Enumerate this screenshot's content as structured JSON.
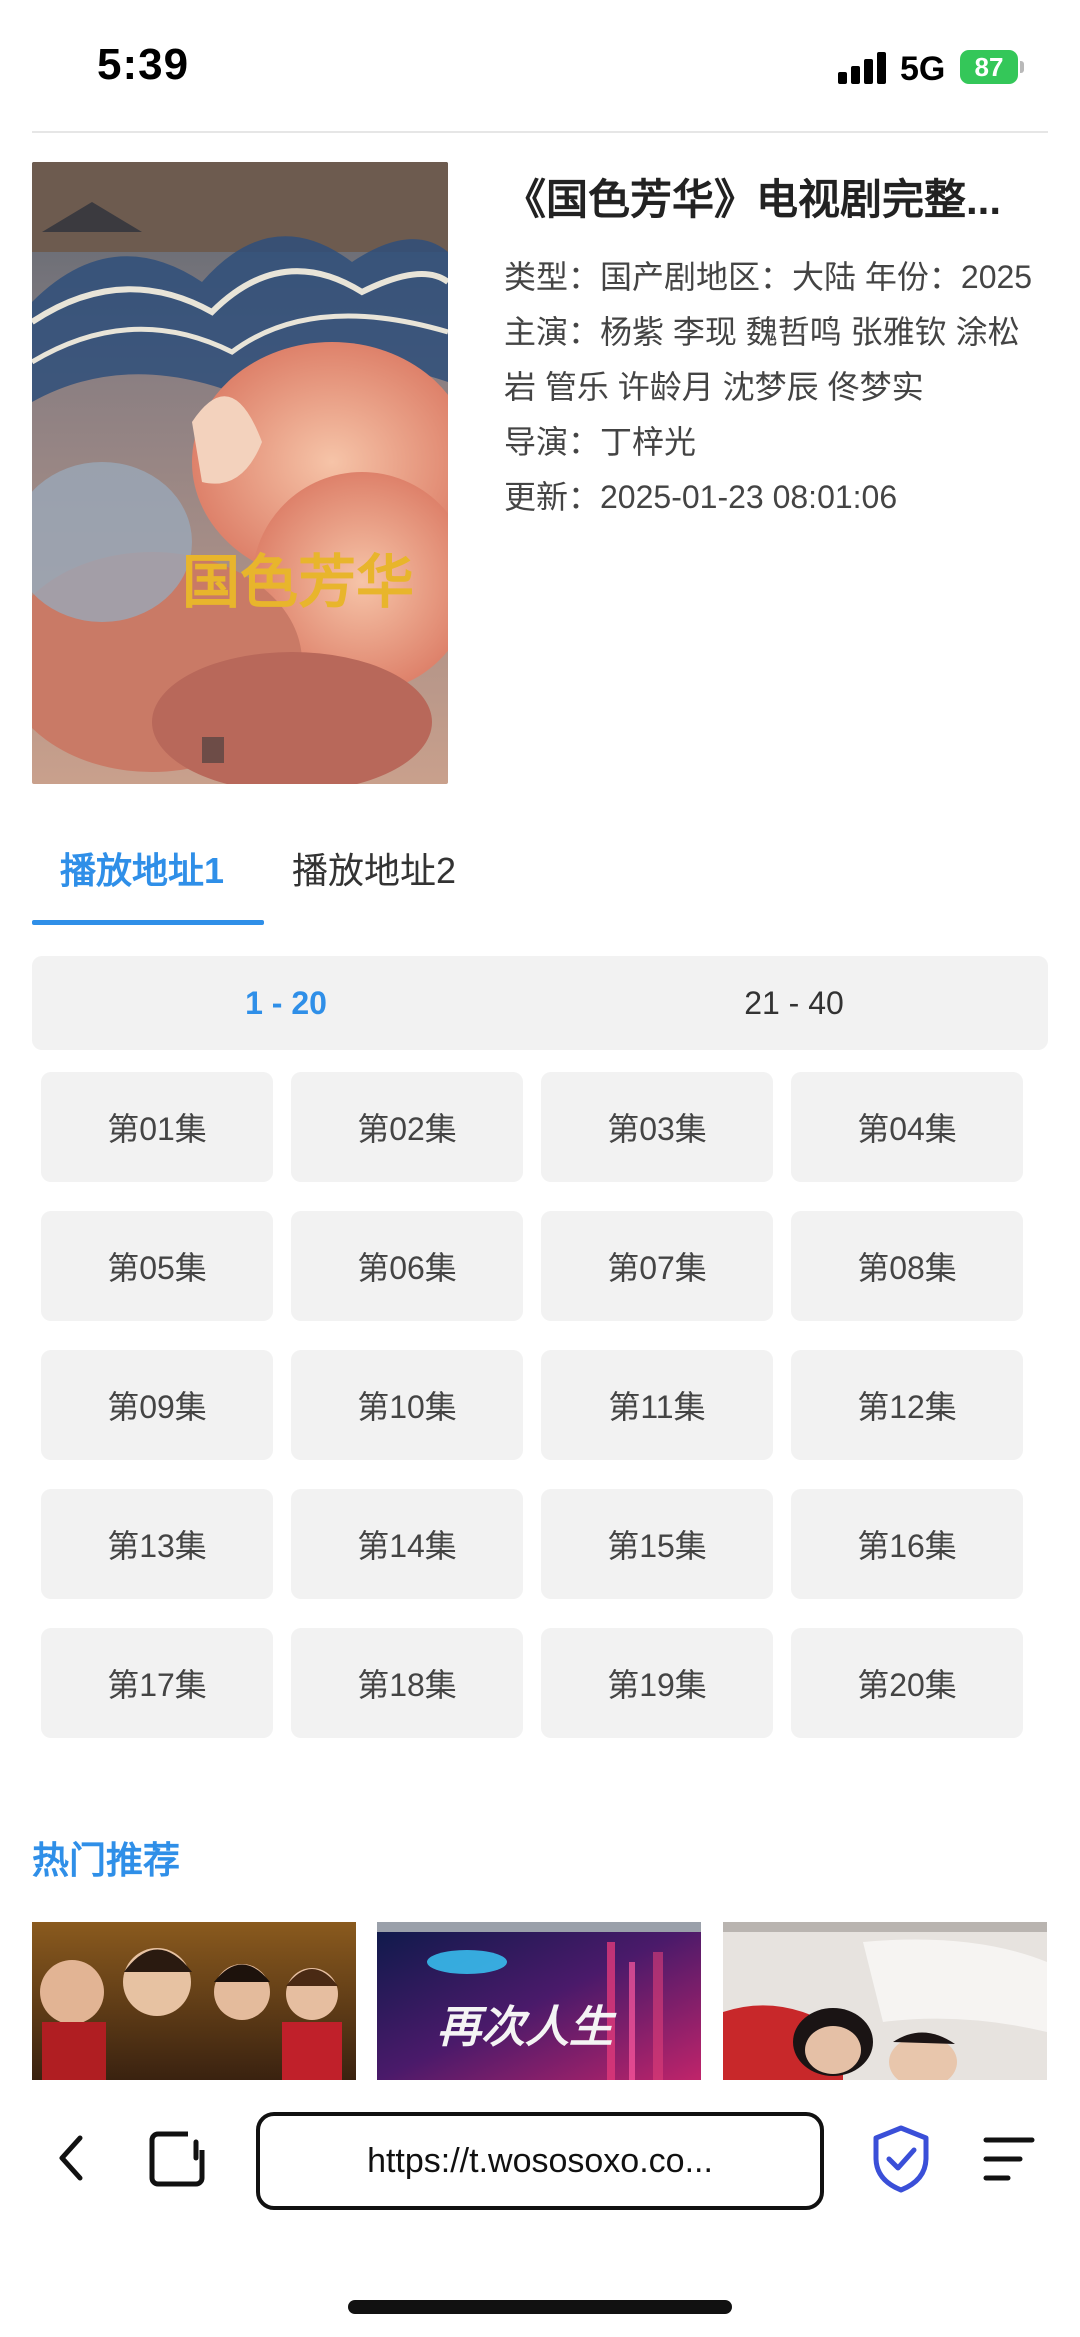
{
  "status_bar": {
    "time": "5:39",
    "network": "5G",
    "battery": "87"
  },
  "detail": {
    "title": "《国色芳华》电视剧完整...",
    "poster_text": "国色芳华",
    "info_lines": [
      "类型：国产剧地区：大陆 年份：2025",
      "主演：杨紫 李现 魏哲鸣 张雅钦 涂松岩 管乐 许龄月 沈梦辰 佟梦实",
      "导演：丁梓光",
      "更新：2025-01-23 08:01:06"
    ]
  },
  "tabs": [
    {
      "label": "播放地址1",
      "active": true
    },
    {
      "label": "播放地址2",
      "active": false
    }
  ],
  "ranges": [
    {
      "label": "1 - 20",
      "active": true
    },
    {
      "label": "21 - 40",
      "active": false
    }
  ],
  "episodes": [
    "第01集",
    "第02集",
    "第03集",
    "第04集",
    "第05集",
    "第06集",
    "第07集",
    "第08集",
    "第09集",
    "第10集",
    "第11集",
    "第12集",
    "第13集",
    "第14集",
    "第15集",
    "第16集",
    "第17集",
    "第18集",
    "第19集",
    "第20集"
  ],
  "recommend": {
    "heading": "热门推荐",
    "thumb2_text": "再次人生"
  },
  "browser": {
    "url": "https://t.wososoxo.co..."
  },
  "colors": {
    "accent": "#2f8fe8",
    "tile_bg": "#f2f2f2",
    "battery": "#34c759",
    "shield": "#3a4fd8"
  }
}
